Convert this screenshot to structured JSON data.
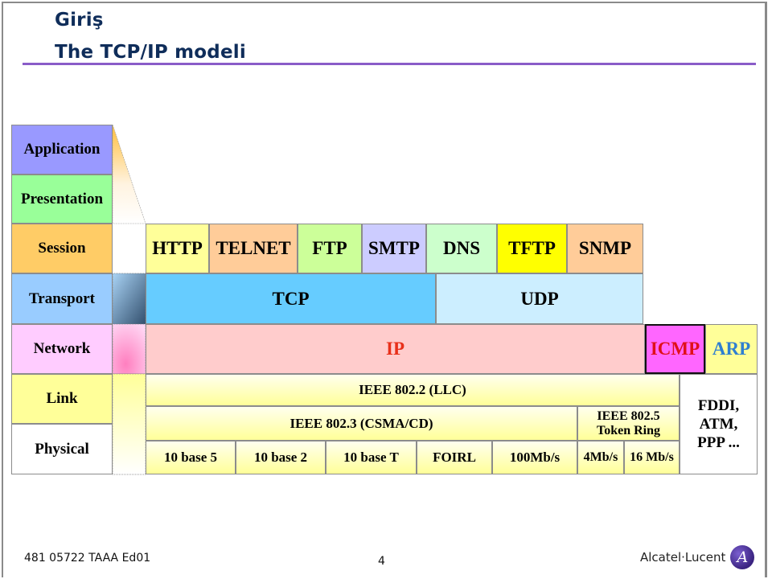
{
  "slide": {
    "title_line1": "Giriş",
    "title_line2": "The TCP/IP modeli",
    "footer_code": "481 05722 TAAA Ed01",
    "page_number": "4",
    "logo_text": "Alcatel·Lucent",
    "logo_mark": "A"
  },
  "osi_layers": [
    {
      "label": "Application",
      "color": "#9999ff"
    },
    {
      "label": "Presentation",
      "color": "#99ff99"
    },
    {
      "label": "Session",
      "color": "#ffcc66"
    },
    {
      "label": "Transport",
      "color": "#99ccff"
    },
    {
      "label": "Network",
      "color": "#ffccff"
    },
    {
      "label": "Link",
      "color": "#ffff99"
    },
    {
      "label": "Physical",
      "color": "#ffffff"
    }
  ],
  "application_protocols": [
    {
      "label": "HTTP",
      "color": "#ffff99"
    },
    {
      "label": "TELNET",
      "color": "#ffcc99"
    },
    {
      "label": "FTP",
      "color": "#ccff99"
    },
    {
      "label": "SMTP",
      "color": "#ccccff"
    },
    {
      "label": "DNS",
      "color": "#ccffcc"
    },
    {
      "label": "TFTP",
      "color": "#ffff00"
    },
    {
      "label": "SNMP",
      "color": "#ffcc99"
    }
  ],
  "transport_protocols": [
    {
      "label": "TCP",
      "color": "#66ccff"
    },
    {
      "label": "UDP",
      "color": "#cceeff"
    }
  ],
  "network_protocols": [
    {
      "label": "IP",
      "color": "#ffcccc",
      "text_color": "#e8301a"
    },
    {
      "label": "ICMP",
      "color": "#ff66ff",
      "text_color": "#e0101a"
    },
    {
      "label": "ARP",
      "color": "#ffff99",
      "text_color": "#2f7fd0"
    }
  ],
  "link_protocols": {
    "llc": "IEEE 802.2 (LLC)",
    "csma": "IEEE 802.3 (CSMA/CD)",
    "token_ring_line1": "IEEE 802.5",
    "token_ring_line2": "Token Ring",
    "other_line1": "FDDI,",
    "other_line2": "ATM,",
    "other_line3": "PPP ...",
    "physical": [
      "10 base 5",
      "10 base 2",
      "10 base T",
      "FOIRL",
      "100Mb/s",
      "4Mb/s",
      "16 Mb/s"
    ]
  },
  "colors": {
    "title": "#0f2d5a",
    "title_rule": "#8a5cc8"
  }
}
